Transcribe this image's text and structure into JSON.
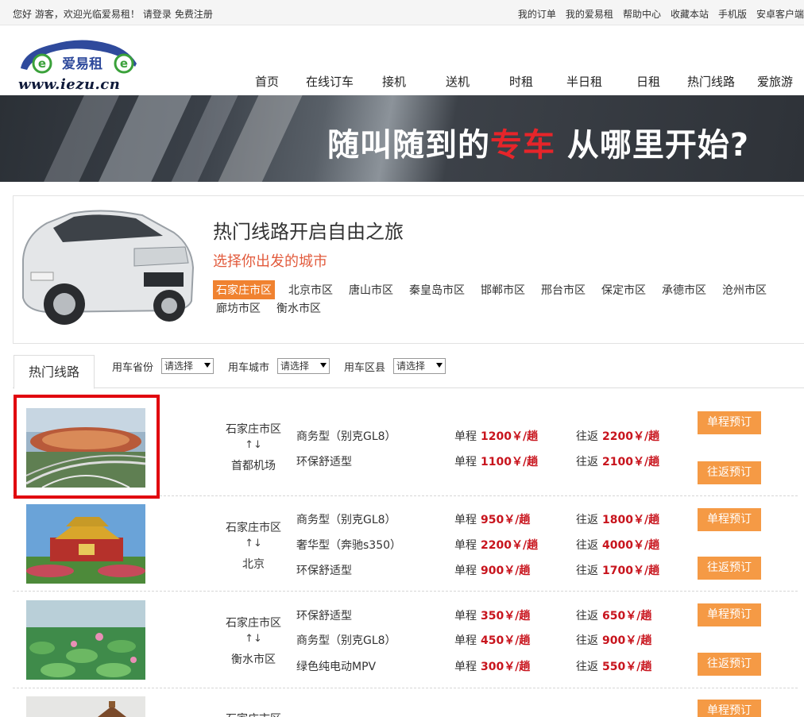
{
  "topbar": {
    "welcome": "您好 游客，欢迎光临爱易租！",
    "login": "请登录",
    "register": "免费注册",
    "links": [
      "我的订单",
      "我的爱易租",
      "帮助中心",
      "收藏本站",
      "手机版",
      "安卓客户端"
    ]
  },
  "logo": {
    "brand": "爱易租",
    "url": "www.iezu.cn"
  },
  "nav": [
    "首页",
    "在线订车",
    "接机",
    "送机",
    "时租",
    "半日租",
    "日租",
    "热门线路",
    "爱旅游"
  ],
  "banner": {
    "before": "随叫随到的",
    "highlight": "专车",
    "after": " 从哪里开始?"
  },
  "citybox": {
    "title": "热门线路开启自由之旅",
    "subtitle": "选择你出发的城市",
    "cities": [
      "石家庄市区",
      "北京市区",
      "唐山市区",
      "秦皇岛市区",
      "邯郸市区",
      "邢台市区",
      "保定市区",
      "承德市区",
      "沧州市区",
      "廊坊市区",
      "衡水市区"
    ],
    "active_city": "石家庄市区"
  },
  "filters": {
    "tab": "热门线路",
    "province_label": "用车省份",
    "city_label": "用车城市",
    "county_label": "用车区县",
    "select_placeholder": "请选择"
  },
  "labels": {
    "one_way": "单程",
    "round_trip": "往返",
    "unit": "￥/趟",
    "one_way_btn": "单程预订",
    "round_trip_btn": "往返预订",
    "arrow": "↑↓"
  },
  "routes": [
    {
      "from": "石家庄市区",
      "to": "首都机场",
      "lines": [
        {
          "type": "商务型（别克GL8）",
          "one_way": "1200",
          "round": "2200"
        },
        {
          "type": "环保舒适型",
          "one_way": "1100",
          "round": "2100"
        }
      ]
    },
    {
      "from": "石家庄市区",
      "to": "北京",
      "lines": [
        {
          "type": "商务型（别克GL8）",
          "one_way": "950",
          "round": "1800"
        },
        {
          "type": "奢华型（奔驰s350）",
          "one_way": "2200",
          "round": "4000"
        },
        {
          "type": "环保舒适型",
          "one_way": "900",
          "round": "1700"
        }
      ]
    },
    {
      "from": "石家庄市区",
      "to": "衡水市区",
      "lines": [
        {
          "type": "环保舒适型",
          "one_way": "350",
          "round": "650"
        },
        {
          "type": "商务型（别克GL8）",
          "one_way": "450",
          "round": "900"
        },
        {
          "type": "绿色纯电动MPV",
          "one_way": "300",
          "round": "550"
        }
      ]
    },
    {
      "from": "石家庄市区",
      "to": "",
      "lines": []
    }
  ],
  "colors": {
    "accent": "#f08230",
    "price": "#c8141d",
    "button": "#f59a45",
    "highlight_box": "#e1070f"
  }
}
